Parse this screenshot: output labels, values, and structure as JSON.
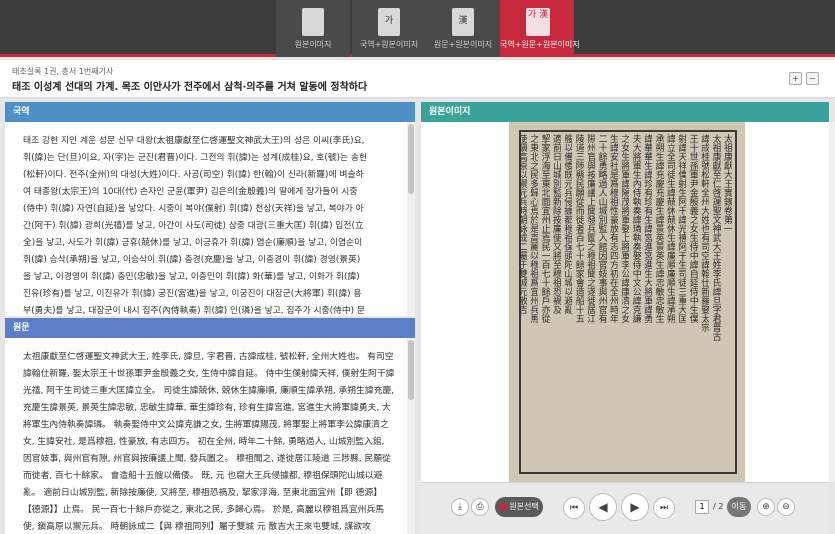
{
  "view_tabs": [
    {
      "icon_text": "",
      "label": "원본이미지",
      "active": false
    },
    {
      "icon_text": "가",
      "label": "국역+원본이미지",
      "active": false
    },
    {
      "icon_text": "漢",
      "label": "원문+원본이미지",
      "active": false
    },
    {
      "icon_text": "가 漢",
      "label": "국역+원문+원본이미지",
      "active": true
    }
  ],
  "header": {
    "breadcrumb": "태조실록 1권, 총서 1번째기사",
    "title": "태조 이성계 선대의 가계. 목조 이안사가 전주에서 삼척·의주를 거쳐 알동에 정착하다",
    "zoom_in": "+",
    "zoom_out": "−"
  },
  "panels": {
    "translation_title": "국역",
    "original_title": "원문",
    "image_title": "원본이미지"
  },
  "translation_lines": [
    "태조 강헌 지인 계운 성문 신무 대왕(太祖康獻至仁啓運聖文神武大王)의 성은 이씨(李氏)요,",
    "휘(諱)는 단(旦)이요, 자(字)는 군진(君晋)이다. 그전의 휘(諱)는 성계(成桂)요, 호(號)는 송헌",
    "(松軒)이다. 전주(全州)의 대성(大姓)이다. 사공(司空) 휘(諱) 한(翰)이 신라(新羅)에 벼슬하",
    "여 태종왕(太宗王)의 10대(代) 손자인 군윤(軍尹) 김은의(金殷義)의 딸에게 장가들어 시중",
    "(侍中) 휘(諱) 자연(自延)을 낳았다. 시중이 복야(僕射) 휘(諱) 천상(天祥)을 낳고, 복야가 아",
    "간(阿干) 휘(諱) 광희(光禧)를 낳고, 아간이 사도(司徒) 삼중 대광(三重大匡) 휘(諱) 입전(立",
    "全)을 낳고, 사도가 휘(諱) 긍휴(兢休)를 낳고, 이긍휴가 휘(諱) 염순(廉順)을 낳고, 이염순이",
    "휘(諱) 승삭(承朔)을 낳고, 이승삭이 휘(諱) 충경(充慶)을 낳고, 이충경이 휘(諱) 경영(景英)",
    "을 낳고, 이경영이 휘(諱) 충민(忠敏)을 낳고, 이충민이 휘(諱) 화(華)를 낳고, 이화가 휘(諱)",
    "진유(珍有)를 낳고, 이진유가 휘(諱) 궁진(宮進)을 낳고, 이궁진이 대장군(大將軍) 휘(諱) 용",
    "부(勇夫)를 낳고, 대장군이 내시 집주(內侍執奏) 휘(諱) 인(璘)을 낳고, 집주가 시중(侍中) 문"
  ],
  "original_lines": [
    "太祖康獻至仁啓運聖文神武大王, 姓李氏, 諱旦, 字君晋, 古諱成桂, 號松軒, 全州大姓也。 有司空",
    "諱翰仕新羅, 娶太宗王十世孫軍尹金殷義之女, 生侍中諱自延。 侍中生僕射諱天祥, 僕射生阿干諱",
    "光禧, 阿干生司徒三重大匡諱立全。 司徒生諱兢休, 兢休生諱廉順, 廉順生諱承朔, 承朔生諱充慶,",
    "充慶生諱景英, 景英生諱忠敏, 忠敏生諱華, 華生諱珍有, 珍有生諱宮進, 宮進生大將軍諱勇夫, 大",
    "將軍生內侍執奏諱璘。 執奏娶侍中文公諱克謙之女, 生將軍諱陽茂, 將軍娶上將軍李公諱康濟之",
    "女, 生諱安社, 是爲穆祖, 性豪放, 有志四方。 初在全州, 時年二十餘, 勇略過人, 山城別監入館,",
    "因官妓事, 與州官有隙, 州官與按廉議上聞, 發兵圖之。 穆祖聞之, 遂徙居江陵道 三陟縣, 民願從",
    "而徙者, 百七十餘家。 會造船十五艘以備倭。 既, 元 也窟大王兵侵據都, 穆祖保頭陀山城以避",
    "亂。 適前日山城別監, 新除按廉使, 又將至, 穆祖恐禍及, 挈家浮海, 至東北面宜州【即 德源】",
    "【德源】】止焉。 民一百七十餘戶亦從之, 東北之民, 多歸心焉。 於是, 高麗以穆祖爲宜州兵馬",
    "使, 鎭高原以禦元兵。 時朝詠成二【與 穆祖同列】屬于雙城 元 散吉大王來屯雙城, 謀欲攻"
  ],
  "viewer": {
    "columns": [
      "太祖康獻大王實錄卷第一",
      "太祖康獻至仁啓運聖文神武大王姓李氏諱旦字君晋古",
      "諱成桂號松軒全州大姓也有司空諱翰仕新羅娶太宗",
      "王十世孫軍尹金殷義之女生侍中諱自延侍中生僕",
      "射諱天祥僕射生阿干諱光禧阿干生司徒三重大匡",
      "諱立全司徒生諱兢休兢休生諱廉順廉順生諱承朔",
      "承朔生諱充慶充慶生諱景英景英生諱忠敏忠敏生",
      "諱華華生諱珍有珍有生諱宮進宮進生大將軍諱勇",
      "夫大將軍生內侍執奏諱璘執奏娶侍中文公諱克謙",
      "之女生將軍諱陽茂將軍娶上將軍李公諱康濟之女",
      "生諱安社是爲穆祖性豪放有志四方初在全州時年",
      "二十餘勇略過人山城別監入館因官妓事與州官有",
      "隙州官與按廉議上聞發兵圖之穆祖聞之遂徙居江",
      "陵道三陟縣民願從而徙者百七十餘家會造船十五",
      "艘以備倭既元兵侵據都穆祖保頭陀山城以避亂",
      "適前日山城別監新除按廉使又將至穆祖恐禍及",
      "挈家浮海至東北面宜州止焉民一百七十餘戶亦從",
      "之東北之民多歸心焉於是高麗以穆祖爲宜州兵馬",
      "使鎭高原以禦元兵時朝詠成二屬于雙城元散吉"
    ],
    "source_button": "원본선택",
    "page_current": "1",
    "page_total": "/ 2",
    "go_button": "이동"
  }
}
